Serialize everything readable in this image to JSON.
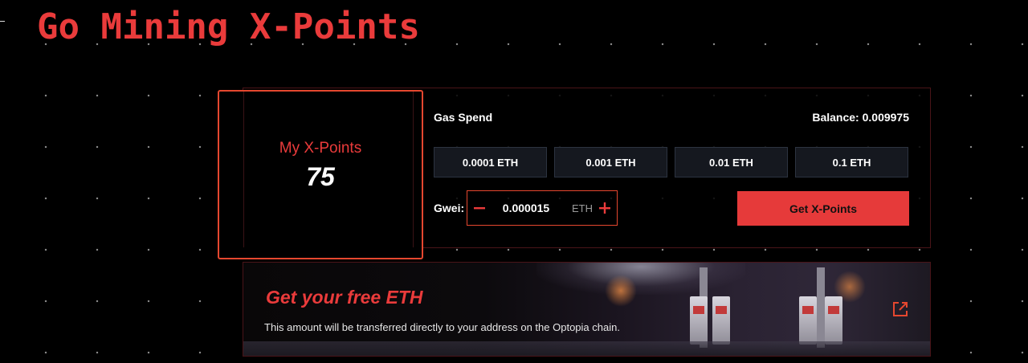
{
  "header": {
    "title": "Go Mining X-Points"
  },
  "points": {
    "label": "My X-Points",
    "value": "75"
  },
  "gas": {
    "label": "Gas Spend",
    "balance": "Balance: 0.009975",
    "options": [
      "0.0001 ETH",
      "0.001 ETH",
      "0.01 ETH",
      "0.1 ETH"
    ]
  },
  "gwei": {
    "label": "Gwei:",
    "value": "0.000015",
    "unit": "ETH",
    "minus_icon": "minus-icon",
    "plus_icon": "plus-icon"
  },
  "action": {
    "label": "Get X-Points"
  },
  "promo": {
    "title": "Get your free ETH",
    "description": "This amount will be transferred directly to your address on the Optopia chain.",
    "icon": "external-link-icon"
  },
  "colors": {
    "accent": "#ea3b3b",
    "button_bg": "#15181f",
    "background": "#000000"
  }
}
